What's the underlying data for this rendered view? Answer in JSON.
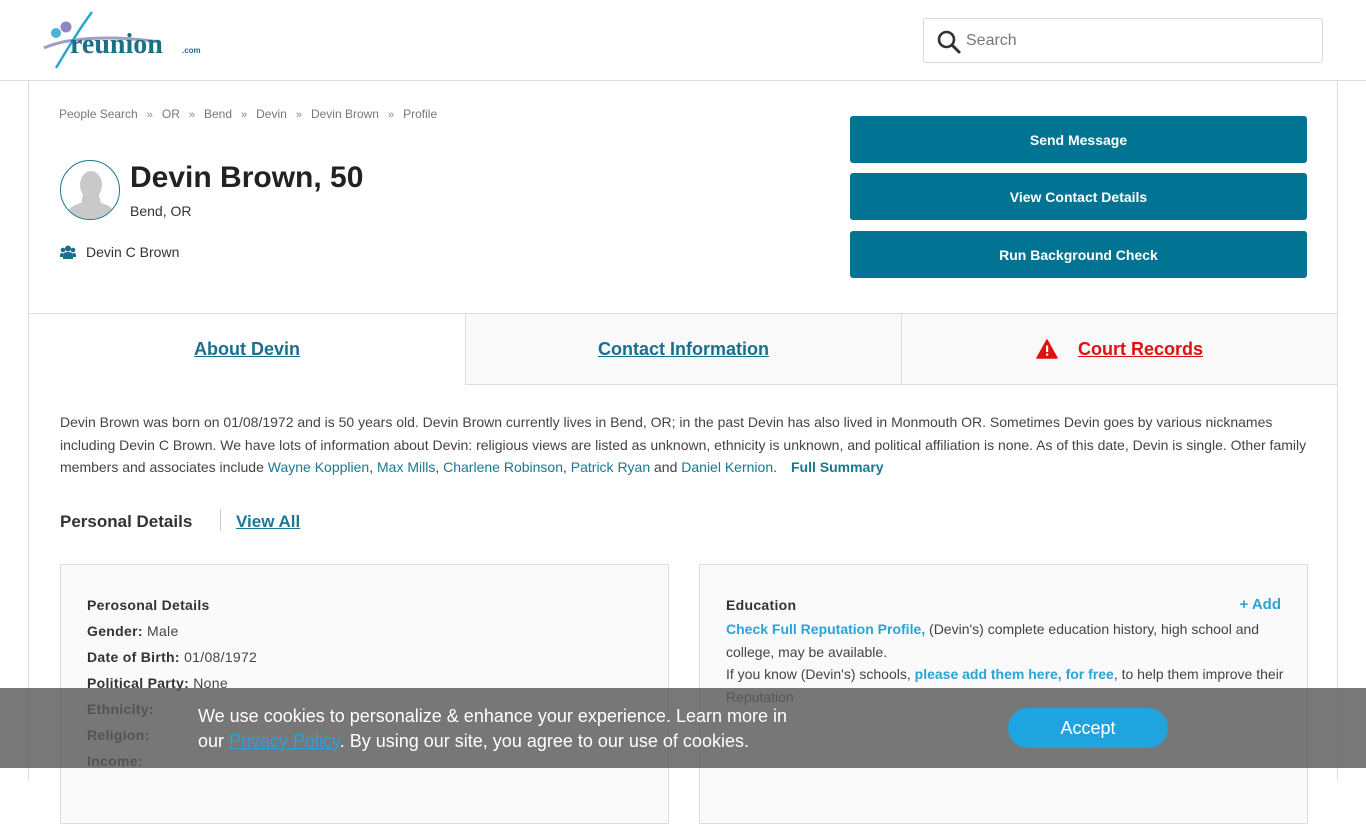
{
  "header": {
    "logo_text": "reunion",
    "logo_suffix": ".com",
    "search": {
      "placeholder": "Search",
      "value": ""
    }
  },
  "breadcrumb": [
    "People Search",
    "OR",
    "Bend",
    "Devin",
    "Devin Brown",
    "Profile"
  ],
  "breadcrumb_separator": "»",
  "profile": {
    "name_age": "Devin Brown, 50",
    "location": "Bend, OR",
    "aka": "Devin C Brown"
  },
  "actions": {
    "send_message": "Send Message",
    "view_contact": "View Contact Details",
    "background_check": "Run Background Check"
  },
  "tabs": [
    {
      "label": "About Devin",
      "active": true
    },
    {
      "label": "Contact Information",
      "active": false
    },
    {
      "label": "Court Records",
      "active": false,
      "icon": "warning-icon"
    }
  ],
  "summary": {
    "text_before": "Devin Brown was born on 01/08/1972 and is 50 years old. Devin Brown currently lives in Bend, OR; in the past Devin has also lived in Monmouth OR. Sometimes Devin goes by various nicknames including Devin C Brown. We have lots of information about Devin: religious views are listed as unknown, ethnicity is unknown, and political affiliation is none. As of this date, Devin is single. Other family members and associates include ",
    "relatives": [
      "Wayne Kopplien",
      "Max Mills",
      "Charlene Robinson",
      "Patrick Ryan",
      "Daniel Kernion"
    ],
    "sep_comma": ", ",
    "sep_and": " and ",
    "end": ".",
    "full_summary": "Full Summary"
  },
  "personal_details": {
    "heading": "Personal Details",
    "view_all": "View All",
    "card_title": "Perosonal Details",
    "rows": [
      {
        "label": "Gender:",
        "value": "Male"
      },
      {
        "label": "Date of Birth:",
        "value": "01/08/1972"
      },
      {
        "label": "Political Party:",
        "value": "None"
      },
      {
        "label": "Ethnicity:",
        "value": ""
      },
      {
        "label": "Religion:",
        "value": ""
      },
      {
        "label": "Income:",
        "value": ""
      }
    ]
  },
  "education": {
    "title": "Education",
    "add": "+ Add",
    "check_link": "Check Full Reputation Profile,",
    "text1": " (Devin's) complete education history, high school and college, may be available.",
    "text2": "If you know (Devin's) schools, ",
    "add_link": "please add them here, for free",
    "text3": ", to help them improve their Reputation"
  },
  "cookie": {
    "text1": "We use cookies to personalize & enhance your experience. Learn more in our ",
    "link": "Privacy Policy",
    "text2": ". By using our site, you agree to our use of cookies.",
    "accept": "Accept"
  },
  "colors": {
    "primary": "#027493",
    "link": "#1a7892",
    "court": "#e01010",
    "accent_light": "#2aa3d6",
    "accept": "#1fa4e0"
  }
}
